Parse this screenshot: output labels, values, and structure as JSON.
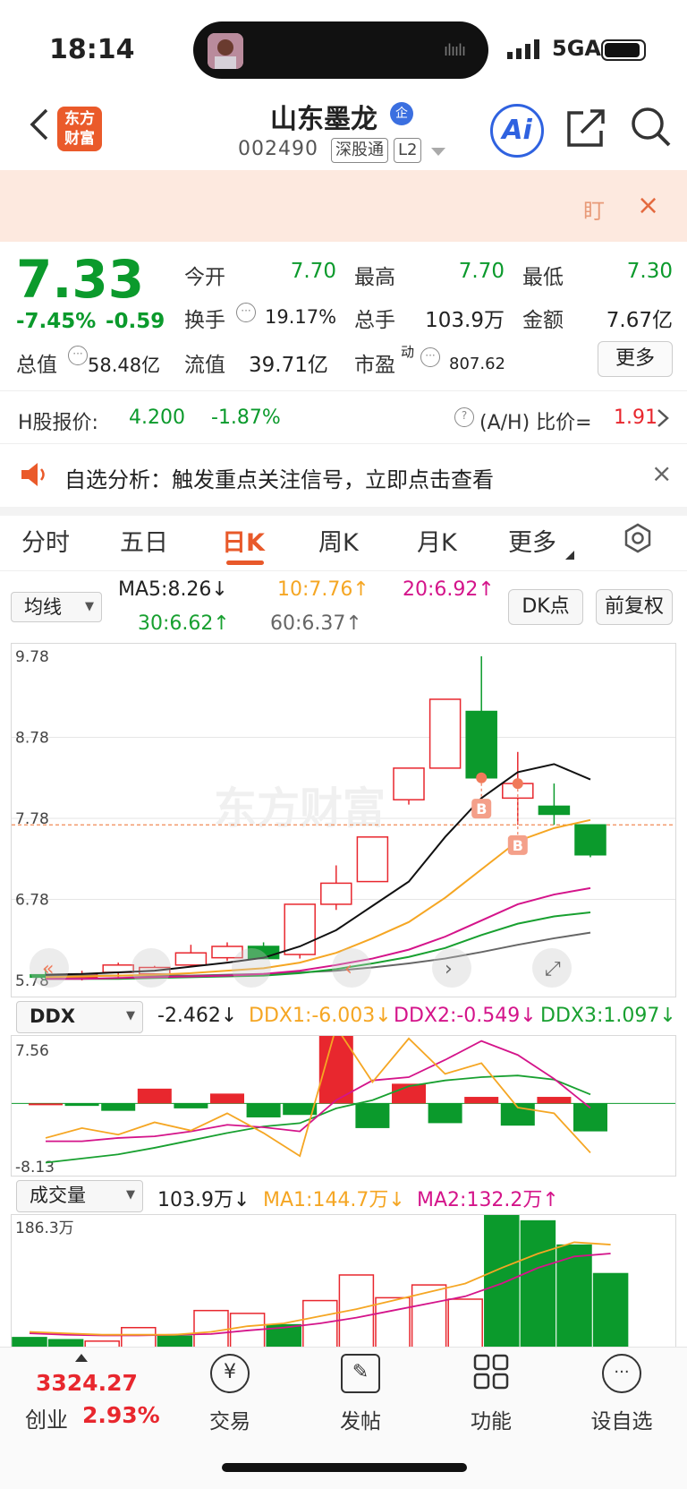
{
  "status_bar": {
    "time": "18:14",
    "network": "5GA"
  },
  "header": {
    "logo_line1": "东方",
    "logo_line2": "财富",
    "stock_name": "山东墨龙",
    "qi_badge": "企",
    "code": "002490",
    "tag1": "深股通",
    "tag2": "L2",
    "ai_label": "Ai"
  },
  "banner": {
    "text": "盯",
    "close": "×"
  },
  "quote": {
    "price": "7.33",
    "change_pct": "-7.45%",
    "change": "-0.59",
    "open_label": "今开",
    "open": "7.70",
    "high_label": "最高",
    "high": "7.70",
    "low_label": "最低",
    "low": "7.30",
    "turnover_label": "换手",
    "turnover": "19.17%",
    "volume_label": "总手",
    "volume": "103.9万",
    "amount_label": "金额",
    "amount": "7.67亿",
    "mktcap_label": "总值",
    "mktcap": "58.48亿",
    "float_label": "流值",
    "float": "39.71亿",
    "pe_label": "市盈",
    "pe_sup": "动",
    "pe": "807.62",
    "more": "更多"
  },
  "h_share": {
    "label": "H股报价:",
    "price": "4.200",
    "change": "-1.87%",
    "ratio_label": "(A/H) 比价=",
    "ratio": "1.91"
  },
  "notice": {
    "text": "自选分析：触发重点关注信号，立即点击查看",
    "close": "×"
  },
  "tabs": [
    "分时",
    "五日",
    "日K",
    "周K",
    "月K",
    "更多"
  ],
  "active_tab": "日K",
  "ma_bar": {
    "selector": "均线",
    "ma5": "MA5:8.26↓",
    "ma10": "10:7.76↑",
    "ma20": "20:6.92↑",
    "ma30": "30:6.62↑",
    "ma60": "60:6.37↑",
    "dk_button": "DK点",
    "adjust_button": "前复权"
  },
  "kline": {
    "y_labels": [
      "9.78",
      "8.78",
      "7.78",
      "6.78",
      "5.78"
    ],
    "ylim": [
      5.78,
      9.78
    ],
    "watermark": "东方财富",
    "marker": "B",
    "colors": {
      "up": "#e8272e",
      "down": "#0b9a2c",
      "ma5": "#111111",
      "ma10": "#f5a623",
      "ma20": "#d4148a",
      "ma30": "#18a030",
      "ma60": "#666666"
    }
  },
  "ddx_bar": {
    "selector": "DDX",
    "ddx": "-2.462↓",
    "ddx1": "DDX1:-6.003↓",
    "ddx2": "DDX2:-0.549↓",
    "ddx3": "DDX3:1.097↓",
    "y_top": "7.56",
    "y_bottom": "-8.13"
  },
  "vol_bar": {
    "selector": "成交量",
    "vol": "103.9万↓",
    "ma1": "MA1:144.7万↓",
    "ma2": "MA2:132.2万↑",
    "y_top": "186.3万"
  },
  "chart_data": {
    "type": "candlestick",
    "candles": [
      {
        "o": 5.85,
        "h": 5.92,
        "l": 5.78,
        "c": 5.82
      },
      {
        "o": 5.82,
        "h": 5.9,
        "l": 5.78,
        "c": 5.86
      },
      {
        "o": 5.88,
        "h": 6.0,
        "l": 5.82,
        "c": 5.97
      },
      {
        "o": 5.86,
        "h": 5.96,
        "l": 5.82,
        "c": 5.94
      },
      {
        "o": 5.97,
        "h": 6.22,
        "l": 5.95,
        "c": 6.12
      },
      {
        "o": 6.06,
        "h": 6.25,
        "l": 6.02,
        "c": 6.2
      },
      {
        "o": 6.2,
        "h": 6.25,
        "l": 6.05,
        "c": 6.05
      },
      {
        "o": 6.1,
        "h": 6.72,
        "l": 6.05,
        "c": 6.72
      },
      {
        "o": 6.72,
        "h": 7.2,
        "l": 6.65,
        "c": 6.98
      },
      {
        "o": 7.0,
        "h": 7.55,
        "l": 7.0,
        "c": 7.55
      },
      {
        "o": 8.01,
        "h": 8.4,
        "l": 7.95,
        "c": 8.4
      },
      {
        "o": 8.4,
        "h": 9.25,
        "l": 8.4,
        "c": 9.25
      },
      {
        "o": 9.1,
        "h": 9.78,
        "l": 8.28,
        "c": 8.28
      },
      {
        "o": 8.03,
        "h": 8.6,
        "l": 7.7,
        "c": 8.21
      },
      {
        "o": 7.93,
        "h": 8.21,
        "l": 7.7,
        "c": 7.83
      },
      {
        "o": 7.7,
        "h": 7.7,
        "l": 7.3,
        "c": 7.33
      }
    ],
    "ma5": [
      5.85,
      5.86,
      5.88,
      5.9,
      5.95,
      6.0,
      6.06,
      6.2,
      6.4,
      6.7,
      7.0,
      7.55,
      8.03,
      8.35,
      8.45,
      8.26
    ],
    "ma10": [
      5.82,
      5.83,
      5.84,
      5.85,
      5.87,
      5.9,
      5.93,
      6.0,
      6.12,
      6.3,
      6.5,
      6.8,
      7.15,
      7.5,
      7.66,
      7.76
    ],
    "ma20": [
      5.8,
      5.8,
      5.81,
      5.82,
      5.83,
      5.84,
      5.86,
      5.9,
      5.97,
      6.05,
      6.16,
      6.32,
      6.52,
      6.72,
      6.84,
      6.92
    ],
    "ma30": [
      5.8,
      5.8,
      5.8,
      5.81,
      5.82,
      5.83,
      5.84,
      5.87,
      5.92,
      5.99,
      6.07,
      6.18,
      6.34,
      6.48,
      6.57,
      6.62
    ],
    "ma60": [
      5.84,
      5.84,
      5.84,
      5.84,
      5.84,
      5.85,
      5.86,
      5.88,
      5.9,
      5.94,
      5.99,
      6.05,
      6.13,
      6.22,
      6.3,
      6.37
    ],
    "ddx": [
      0.0,
      -0.3,
      -0.9,
      1.8,
      -0.6,
      1.2,
      -1.7,
      -1.4,
      10.0,
      -3.0,
      2.4,
      -2.4,
      0.8,
      -2.7,
      0.8,
      -3.4
    ],
    "ddx1": [
      -4.2,
      -3.0,
      -3.8,
      -2.3,
      -3.3,
      -1.2,
      -3.6,
      -6.4,
      9.3,
      2.6,
      7.9,
      3.6,
      4.9,
      -0.5,
      -1.2,
      -6.0
    ],
    "ddx2": [
      -4.6,
      -4.6,
      -4.2,
      -4.0,
      -3.4,
      -2.6,
      -2.9,
      -3.4,
      0.4,
      2.8,
      3.2,
      5.3,
      7.6,
      5.9,
      3.0,
      -0.55
    ],
    "ddx3": [
      -7.2,
      -6.7,
      -6.2,
      -5.4,
      -4.5,
      -3.6,
      -2.8,
      -2.4,
      -0.6,
      0.4,
      2.1,
      2.8,
      3.2,
      3.4,
      2.9,
      1.1
    ],
    "ddx_ylim": [
      -8.13,
      7.56
    ],
    "volume": [
      14,
      11,
      9,
      28,
      16,
      52,
      48,
      32,
      66,
      102,
      70,
      88,
      68,
      186.3,
      168,
      148,
      103.9
    ],
    "volume_visible": [
      14,
      11,
      9,
      28,
      16,
      52,
      48,
      32,
      66,
      102,
      70,
      88,
      68,
      186.3,
      178,
      144,
      103.9
    ],
    "vol_ma1": [
      22,
      20,
      18,
      18,
      18,
      22,
      30,
      34,
      44,
      54,
      66,
      78,
      90,
      112,
      132,
      148,
      144.7
    ],
    "vol_ma2": [
      20,
      18,
      17,
      17,
      18,
      19,
      24,
      28,
      34,
      42,
      52,
      62,
      72,
      90,
      112,
      128,
      132.2
    ],
    "vol_ylim": [
      0,
      186.3
    ]
  },
  "bottom_nav": {
    "index_value": "3324.27",
    "index_label": "创业",
    "index_change": "2.93%",
    "items": [
      {
        "label": "交易",
        "icon": "yen-icon"
      },
      {
        "label": "发帖",
        "icon": "edit-icon"
      },
      {
        "label": "功能",
        "icon": "grid-icon"
      },
      {
        "label": "设自选",
        "icon": "more-icon"
      }
    ]
  }
}
